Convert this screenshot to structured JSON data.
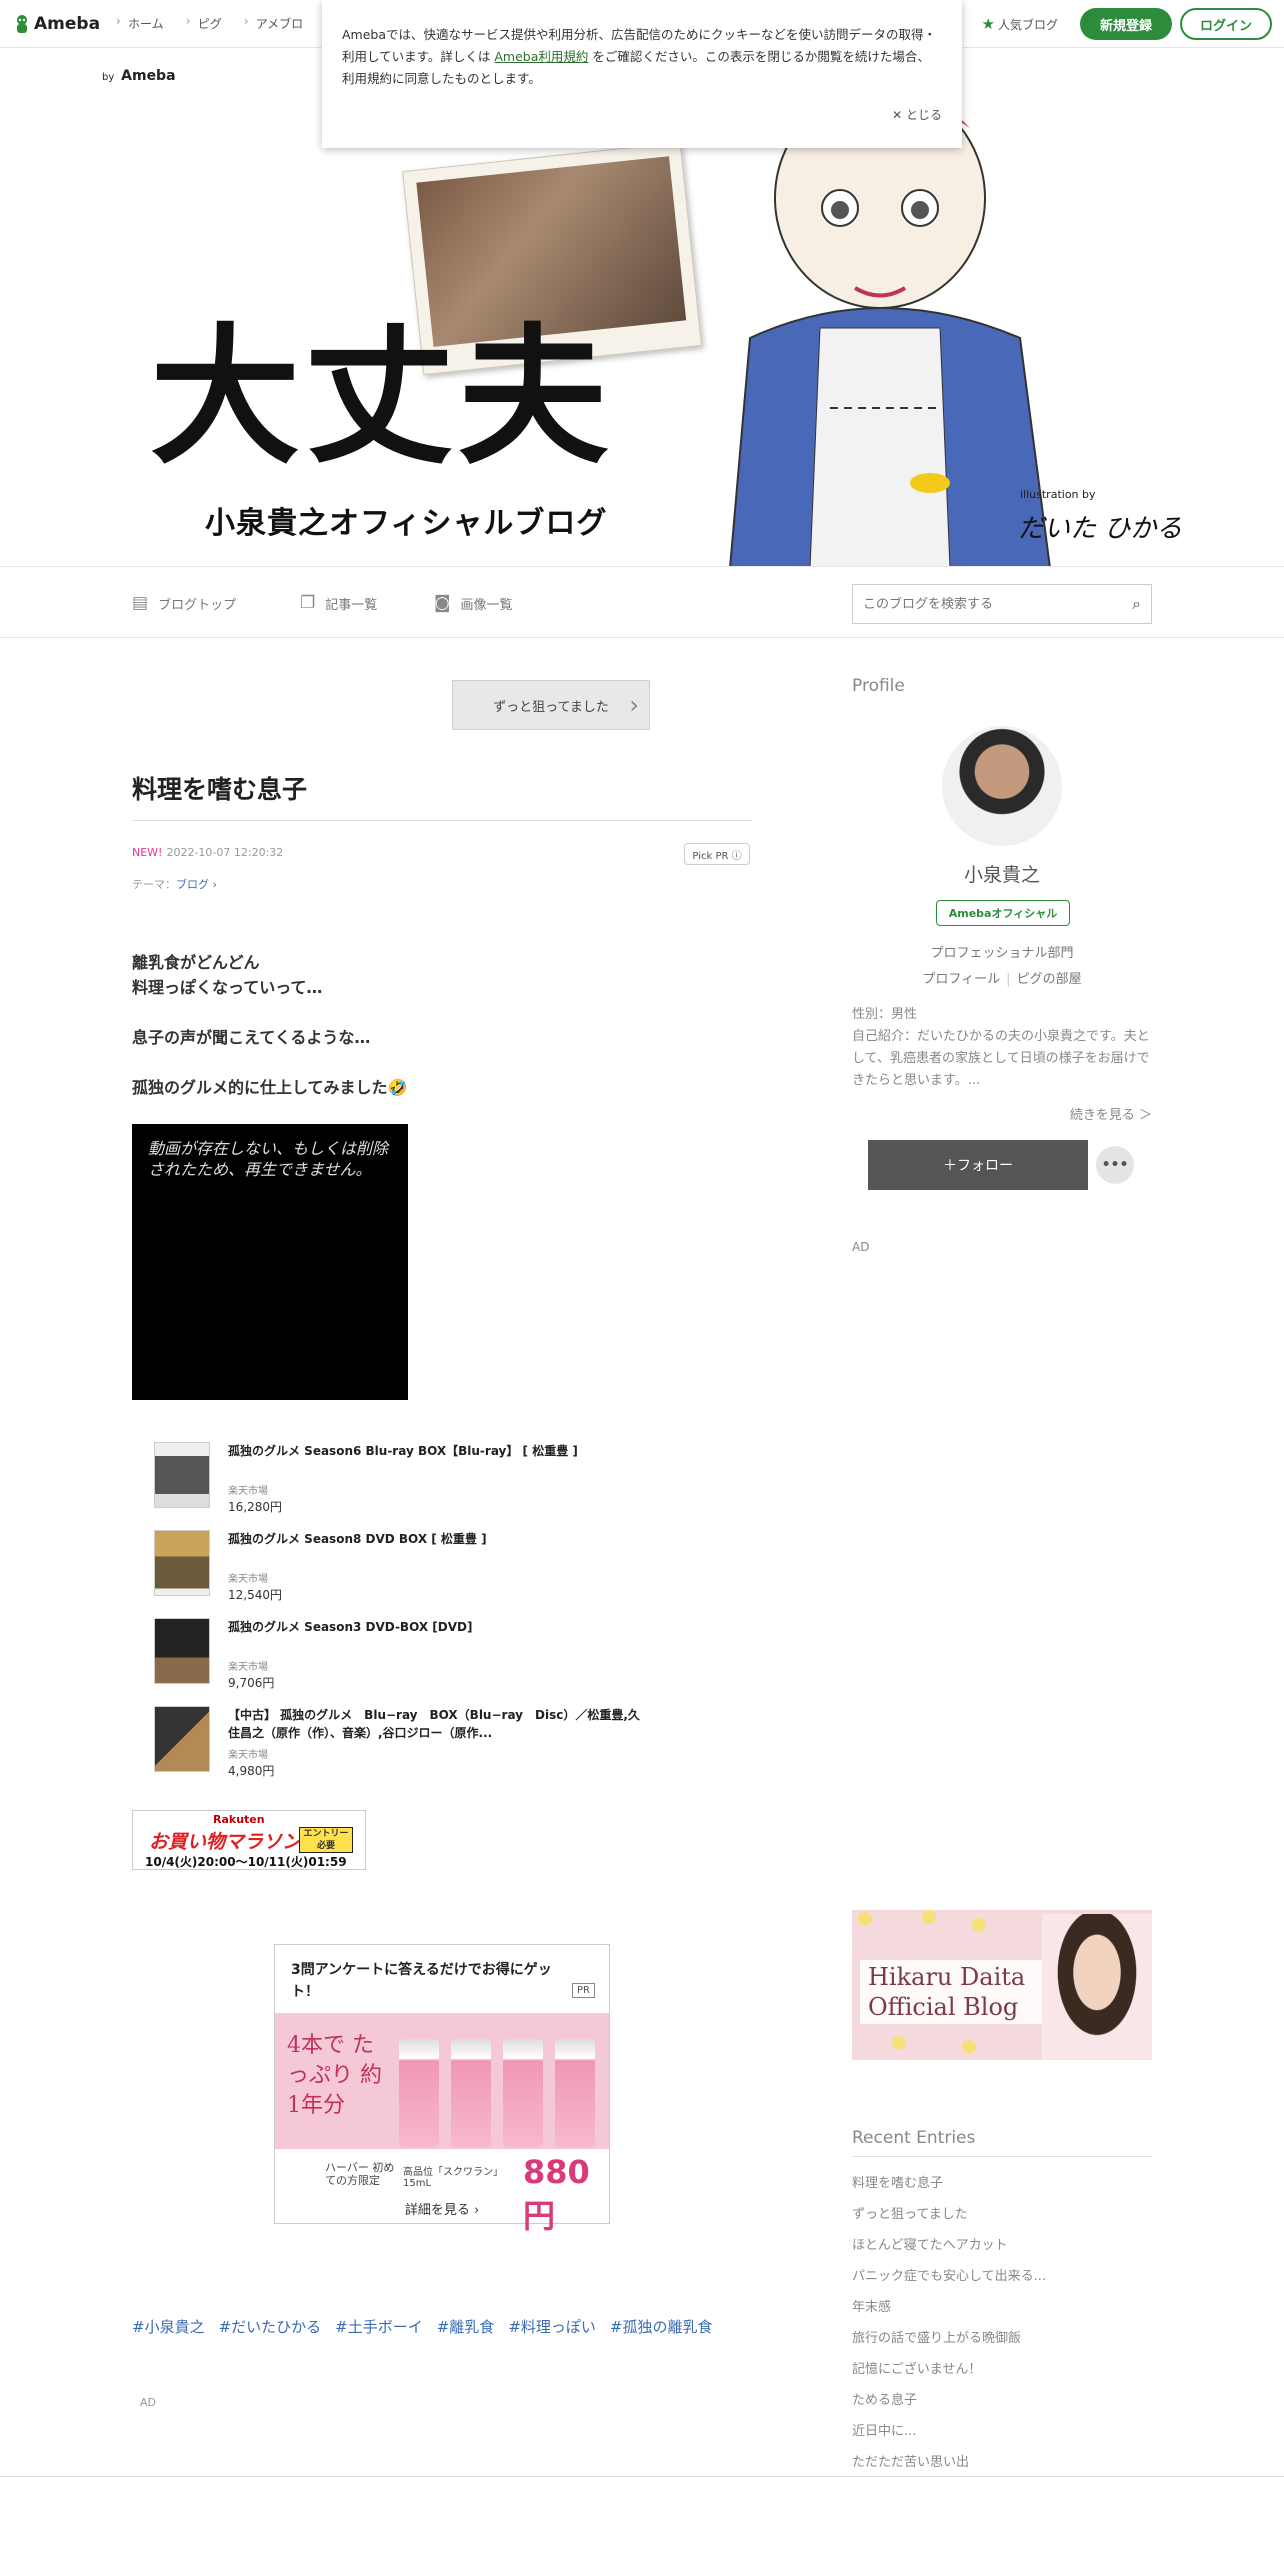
{
  "topnav": {
    "brand": "Ameba",
    "links": [
      "ホーム",
      "ピグ",
      "アメブロ"
    ],
    "popular": "人気ブログ",
    "register": "新規登録",
    "login": "ログイン"
  },
  "cookie": {
    "text_before": "Amebaでは、快適なサービス提供や利用分析、広告配信のためにクッキーなどを使い訪問データの取得・利用しています。詳しくは ",
    "link": "Ameba利用規約",
    "text_after": " をご確認ください。この表示を閉じるか閲覧を続けた場合、利用規約に同意したものとします。",
    "close": "とじる"
  },
  "header": {
    "by": "by",
    "brand": "Ameba",
    "title": "大丈夫",
    "subtitle": "小泉貴之オフィシャルブログ",
    "credit_small": "illustration by",
    "credit_name": "だいた ひかる"
  },
  "blognav": {
    "top": "ブログトップ",
    "list": "記事一覧",
    "images": "画像一覧",
    "search_placeholder": "このブログを検索する"
  },
  "article": {
    "prev": "ずっと狙ってました",
    "title": "料理を嗜む息子",
    "new": "NEW!",
    "date": "2022-10-07 12:20:32",
    "pickpr": "Pick PR ⓘ",
    "theme_label": "テーマ：",
    "theme": "ブログ ›",
    "lines": [
      "離乳食がどんどん",
      "料理っぽくなっていって…",
      "息子の声が聞こえてくるような…",
      "孤独のグルメ的に仕上してみました🤣"
    ],
    "video_msg": "動画が存在しない、もしくは削除されたため、再生できません。"
  },
  "products": [
    {
      "name": "孤独のグルメ Season6 Blu-ray BOX【Blu-ray】 [ 松重豊 ]",
      "shop": "楽天市場",
      "price": "16,280円"
    },
    {
      "name": "孤独のグルメ Season8 DVD BOX [ 松重豊 ]",
      "shop": "楽天市場",
      "price": "12,540円"
    },
    {
      "name": "孤独のグルメ Season3 DVD-BOX [DVD]",
      "shop": "楽天市場",
      "price": "9,706円"
    },
    {
      "name": "【中古】 孤独のグルメ　Blu−ray　BOX（Blu−ray　Disc）／松重豊,久住昌之（原作（作）、音楽）,谷口ジロー（原作...",
      "shop": "楽天市場",
      "price": "4,980円"
    }
  ],
  "rakuten": {
    "brand": "Rakuten",
    "title": "お買い物マラソン",
    "entry": "エントリー必要",
    "dates": "10/4(火)20:00〜10/11(火)01:59"
  },
  "ad": {
    "question": "3問アンケートに答えるだけでお得にゲット！",
    "pr": "PR",
    "big": "4本で たっぷり 約1年分",
    "haba": "HABA",
    "sub": "ハーバー 初めての方限定",
    "size": "高品位「スクワラン」15mL",
    "price": "880円",
    "more": "詳細を見る ›"
  },
  "tags": [
    "#小泉貴之",
    "#だいたひかる",
    "#土手ボーイ",
    "#離乳食",
    "#料理っぽい",
    "#孤独の離乳食"
  ],
  "ad_label": "AD",
  "sidebar": {
    "profile_heading": "Profile",
    "name": "小泉貴之",
    "badge": "Amebaオフィシャル",
    "dept": "プロフェッショナル部門",
    "link_profile": "プロフィール",
    "link_pig": "ピグの部屋",
    "gender": "性別：男性",
    "bio": "自己紹介：だいたひかるの夫の小泉貴之です。夫として、乳癌患者の家族として日頃の様子をお届けできたらと思います。...",
    "readmore": "続きを見る ＞",
    "follow": "＋フォロー",
    "more": "•••",
    "ad": "AD",
    "banner": "Hikaru Daita Official Blog",
    "recent_heading": "Recent Entries",
    "recent": [
      "料理を嗜む息子",
      "ずっと狙ってました",
      "ほとんど寝てたヘアカット",
      "パニック症でも安心して出来る...",
      "年末感",
      "旅行の話で盛り上がる晩御飯",
      "記憶にございません！",
      "ためる息子",
      "近日中に...",
      "ただただ苦い思い出"
    ]
  },
  "colors": {
    "accent": "#2d8c3c",
    "link": "#3a6cb5",
    "new": "#e0368a"
  }
}
